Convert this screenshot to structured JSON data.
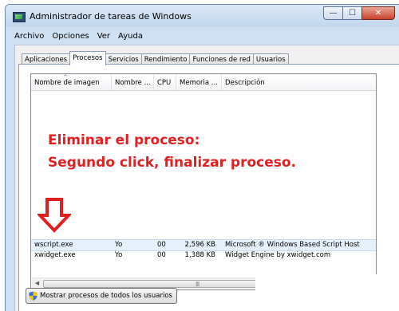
{
  "window": {
    "title": "Administrador de tareas de Windows"
  },
  "caption": {
    "minimize": "—",
    "maximize": "☐",
    "close": "✕"
  },
  "menu": [
    "Archivo",
    "Opciones",
    "Ver",
    "Ayuda"
  ],
  "tabs": [
    "Aplicaciones",
    "Procesos",
    "Servicios",
    "Rendimiento",
    "Funciones de red",
    "Usuarios"
  ],
  "active_tab": "Procesos",
  "table": {
    "columns": [
      "Nombre de imagen",
      "Nombre ...",
      "CPU",
      "Memoria ...",
      "Descripción"
    ],
    "sort_indicator": "^",
    "rows": [
      {
        "name": "wscript.exe",
        "user": "Yo",
        "cpu": "00",
        "memory": "2,596 KB",
        "description": "Microsoft ® Windows Based Script Host"
      },
      {
        "name": "xwidget.exe",
        "user": "Yo",
        "cpu": "00",
        "memory": "1,388 KB",
        "description": "Widget Engine by xwidget.com"
      }
    ]
  },
  "annotation": {
    "line1": "Eliminar el proceso:",
    "line2": "Segundo click, finalizar proceso.",
    "color": "#e02020"
  },
  "scrollbar": {
    "left_arrow": "◀",
    "right_arrow": "▶",
    "grip": "||||"
  },
  "buttons": {
    "show_all": "Mostrar procesos de todos los usuarios"
  }
}
